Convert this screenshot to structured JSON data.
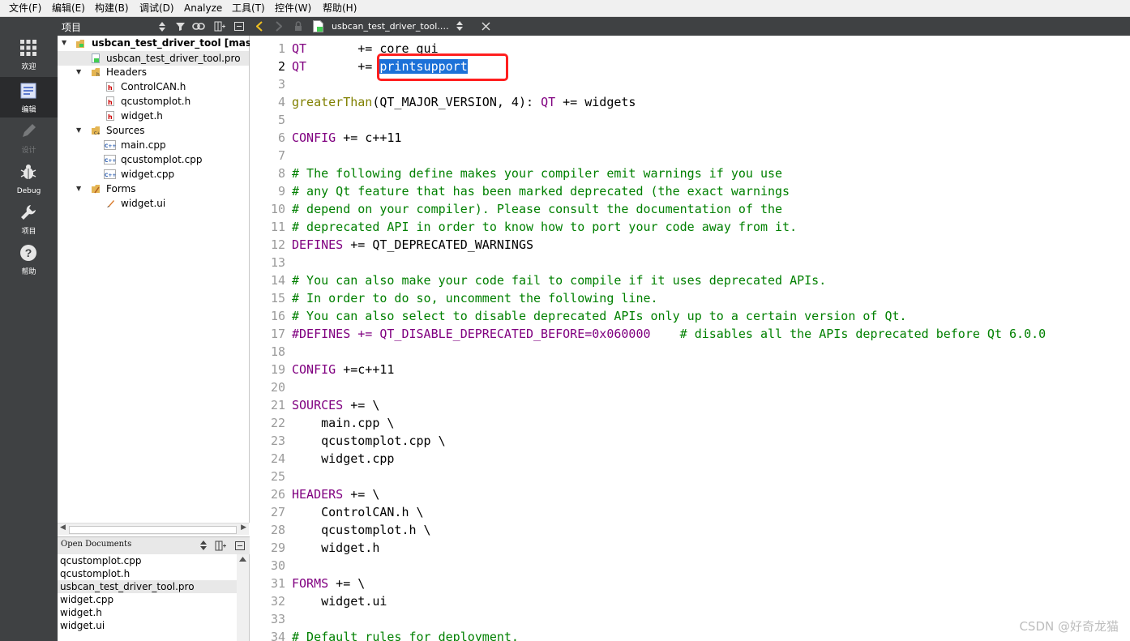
{
  "menu": [
    "文件(F)",
    "编辑(E)",
    "构建(B)",
    "调试(D)",
    "Analyze",
    "工具(T)",
    "控件(W)",
    "帮助(H)"
  ],
  "modes": [
    {
      "label": "欢迎",
      "icon": "grid-icon"
    },
    {
      "label": "编辑",
      "icon": "document-icon"
    },
    {
      "label": "设计",
      "icon": "pencil-icon"
    },
    {
      "label": "Debug",
      "icon": "bug-icon"
    },
    {
      "label": "项目",
      "icon": "wrench-icon"
    },
    {
      "label": "帮助",
      "icon": "help-icon"
    }
  ],
  "project_panel": {
    "title": "项目",
    "tree": {
      "root": "usbcan_test_driver_tool [master]",
      "pro_file": "usbcan_test_driver_tool.pro",
      "headers": "Headers",
      "header_files": [
        "ControlCAN.h",
        "qcustomplot.h",
        "widget.h"
      ],
      "sources": "Sources",
      "source_files": [
        "main.cpp",
        "qcustomplot.cpp",
        "widget.cpp"
      ],
      "forms": "Forms",
      "form_files": [
        "widget.ui"
      ]
    }
  },
  "open_documents": {
    "title": "Open Documents",
    "items": [
      "qcustomplot.cpp",
      "qcustomplot.h",
      "usbcan_test_driver_tool.pro",
      "widget.cpp",
      "widget.h",
      "widget.ui"
    ],
    "current": "usbcan_test_driver_tool.pro"
  },
  "editor": {
    "tab_label": "usbcan_test_driver_tool.…",
    "current_line": "2",
    "selected_text": "printsupport",
    "line_numbers": [
      "1",
      "2",
      "3",
      "4",
      "5",
      "6",
      "7",
      "8",
      "9",
      "10",
      "11",
      "12",
      "13",
      "14",
      "15",
      "16",
      "17",
      "18",
      "19",
      "20",
      "21",
      "22",
      "23",
      "24",
      "25",
      "26",
      "27",
      "28",
      "29",
      "30",
      "31",
      "32",
      "33",
      "34"
    ],
    "lines": {
      "l1_var": "QT",
      "l1_rest": "       += core gui",
      "l2_var": "QT",
      "l2_rest": "       += ",
      "l4_fn": "greaterThan",
      "l4_mid": "(QT_MAJOR_VERSION, 4): ",
      "l4_var": "QT",
      "l4_rest": " += widgets",
      "l6_var": "CONFIG",
      "l6_rest": " += c++11",
      "l8": "# The following define makes your compiler emit warnings if you use",
      "l9": "# any Qt feature that has been marked deprecated (the exact warnings",
      "l10": "# depend on your compiler). Please consult the documentation of the",
      "l11": "# deprecated API in order to know how to port your code away from it.",
      "l12_var": "DEFINES",
      "l12_rest": " += QT_DEPRECATED_WARNINGS",
      "l14": "# You can also make your code fail to compile if it uses deprecated APIs.",
      "l15": "# In order to do so, uncomment the following line.",
      "l16": "# You can also select to disable deprecated APIs only up to a certain version of Qt.",
      "l17_code": "#DEFINES += QT_DISABLE_DEPRECATED_BEFORE=0x060000    ",
      "l17_comment": "# disables all the APIs deprecated before Qt 6.0.0",
      "l19_var": "CONFIG",
      "l19_rest": " +=c++11",
      "l21_var": "SOURCES",
      "l21_rest": " += \\",
      "l22": "    main.cpp \\",
      "l23": "    qcustomplot.cpp \\",
      "l24": "    widget.cpp",
      "l26_var": "HEADERS",
      "l26_rest": " += \\",
      "l27": "    ControlCAN.h \\",
      "l28": "    qcustomplot.h \\",
      "l29": "    widget.h",
      "l31_var": "FORMS",
      "l31_rest": " += \\",
      "l32": "    widget.ui",
      "l34": "# Default rules for deployment."
    }
  },
  "watermark": "CSDN @好奇龙猫",
  "colors": {
    "keyword": "#800080",
    "comment": "#008000",
    "function": "#808000",
    "selection": "#1c71d8",
    "highlight_box": "#ff1f1f",
    "sidebar": "#3f4143"
  }
}
